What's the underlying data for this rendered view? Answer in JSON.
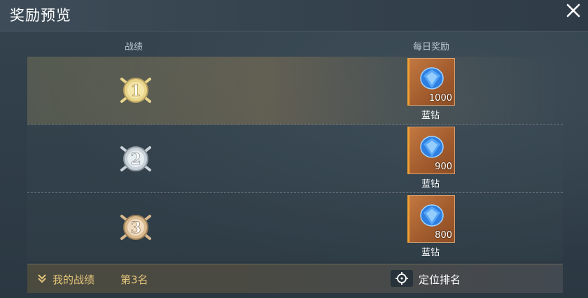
{
  "header": {
    "title": "奖励预览"
  },
  "columns": {
    "record": "战绩",
    "daily_reward": "每日奖励"
  },
  "rows": [
    {
      "rank": "1",
      "reward": {
        "amount": "1000",
        "name": "蓝钻"
      }
    },
    {
      "rank": "2",
      "reward": {
        "amount": "900",
        "name": "蓝钻"
      }
    },
    {
      "rank": "3",
      "reward": {
        "amount": "800",
        "name": "蓝钻"
      }
    }
  ],
  "footer": {
    "my_record_label": "我的战绩",
    "my_rank": "第3名",
    "locate_label": "定位排名"
  },
  "colors": {
    "gold": "#e8d58a",
    "silver": "#c9d2d8",
    "bronze": "#d9b98e",
    "reward_bg": "#b06632",
    "gem": "#2f7fe0",
    "accent_text": "#e6c67a"
  },
  "icons": {
    "close": "close-icon",
    "medal": "rank-medal-icon",
    "gem": "blue-diamond-icon",
    "chevron": "double-chevron-down-icon",
    "locate": "crosshair-icon"
  }
}
